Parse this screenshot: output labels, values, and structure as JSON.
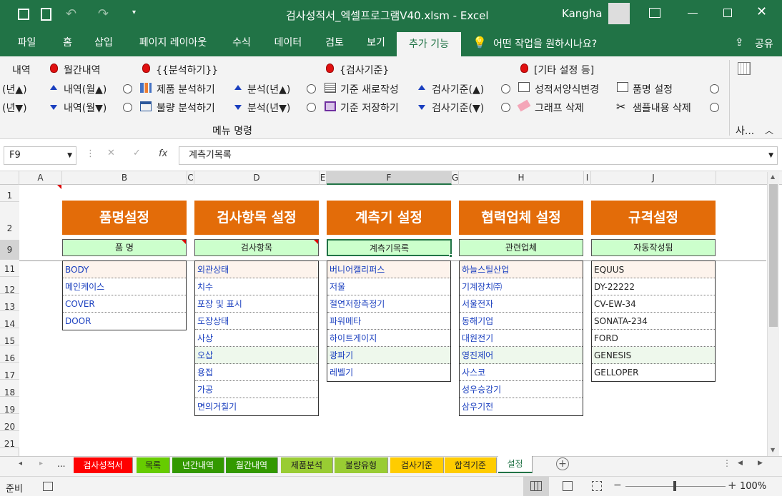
{
  "window": {
    "title": "검사성적서_엑셀프로그램V40.xlsm  -  Excel",
    "user": "Kangha"
  },
  "tabs": [
    "파일",
    "홈",
    "삽입",
    "페이지 레이아웃",
    "수식",
    "데이터",
    "검토",
    "보기",
    "추가 기능"
  ],
  "tell_me": "어떤 작업을 원하시나요?",
  "share": "공유",
  "ribbon": {
    "g1": {
      "top": "내역",
      "r1": "(년▲)",
      "r2": "(년▼)"
    },
    "g2": {
      "top": "월간내역",
      "r1": "내역(월▲)",
      "r2": "내역(월▼)"
    },
    "g3": {
      "top": "{{분석하기}}",
      "r1": "제품 분석하기",
      "r2": "불량 분석하기",
      "r1b": "분석(년▲)",
      "r2b": "분석(년▼)"
    },
    "g4": {
      "top": "{검사기준}",
      "r1": "기준 새로작성",
      "r2": "기준 저장하기",
      "r1b": "검사기준(▲)",
      "r2b": "검사기준(▼)"
    },
    "g5": {
      "top": "[기타 설정 등]",
      "r1": "성적서양식변경",
      "r2": "그래프 삭제",
      "r1b": "품명 설정",
      "r2b": "샘플내용 삭제"
    },
    "group_label": "메뉴 명령",
    "right_label": "사..."
  },
  "formula": {
    "cell": "F9",
    "fx": "fx",
    "value": "계측기목록"
  },
  "columns": [
    "A",
    "B",
    "C",
    "D",
    "E",
    "F",
    "G",
    "H",
    "I",
    "J"
  ],
  "rows": [
    "1",
    "2",
    "9",
    "11",
    "12",
    "13",
    "14",
    "15",
    "16",
    "17",
    "18",
    "19",
    "20",
    "21"
  ],
  "headers": [
    "품명설정",
    "검사항목 설정",
    "계측기 설정",
    "협력업체 설정",
    "규격설정"
  ],
  "subheaders": [
    "품  명",
    "검사항목",
    "계측기목록",
    "관련업체",
    "자동작성됨"
  ],
  "lists": {
    "b": [
      "BODY",
      "메인케이스",
      "COVER",
      "DOOR"
    ],
    "d": [
      "외관상태",
      "치수",
      "포장 및 표시",
      "도장상태",
      "사상",
      "오삽",
      "용접",
      "가공",
      "면의거칠기"
    ],
    "f": [
      "버니어캘리퍼스",
      "저울",
      "절연저항측정기",
      "파워메타",
      "하이트게이지",
      "광파기",
      "레벨기"
    ],
    "h": [
      "하늘스틸산업",
      "기계장치㈜",
      "서울전자",
      "동해기업",
      "대원전기",
      "영진제어",
      "사스코",
      "성우승강기",
      "삼우기전"
    ],
    "j": [
      "EQUUS",
      "DY-22222",
      "CV-EW-34",
      "SONATA-234",
      "FORD",
      "GENESIS",
      "GELLOPER"
    ]
  },
  "sheets": [
    "검사성적서",
    "목록",
    "년간내역",
    "월간내역",
    "제품분석",
    "불량유형",
    "검사기준",
    "합격기준",
    "설정"
  ],
  "sheet_colors": [
    "#ff0000",
    "#66cc00",
    "#339900",
    "#339900",
    "#99cc33",
    "#99cc33",
    "#ffcc00",
    "#ffcc00",
    "#f3f3f3"
  ],
  "status": {
    "ready": "준비",
    "zoom": "100%"
  }
}
